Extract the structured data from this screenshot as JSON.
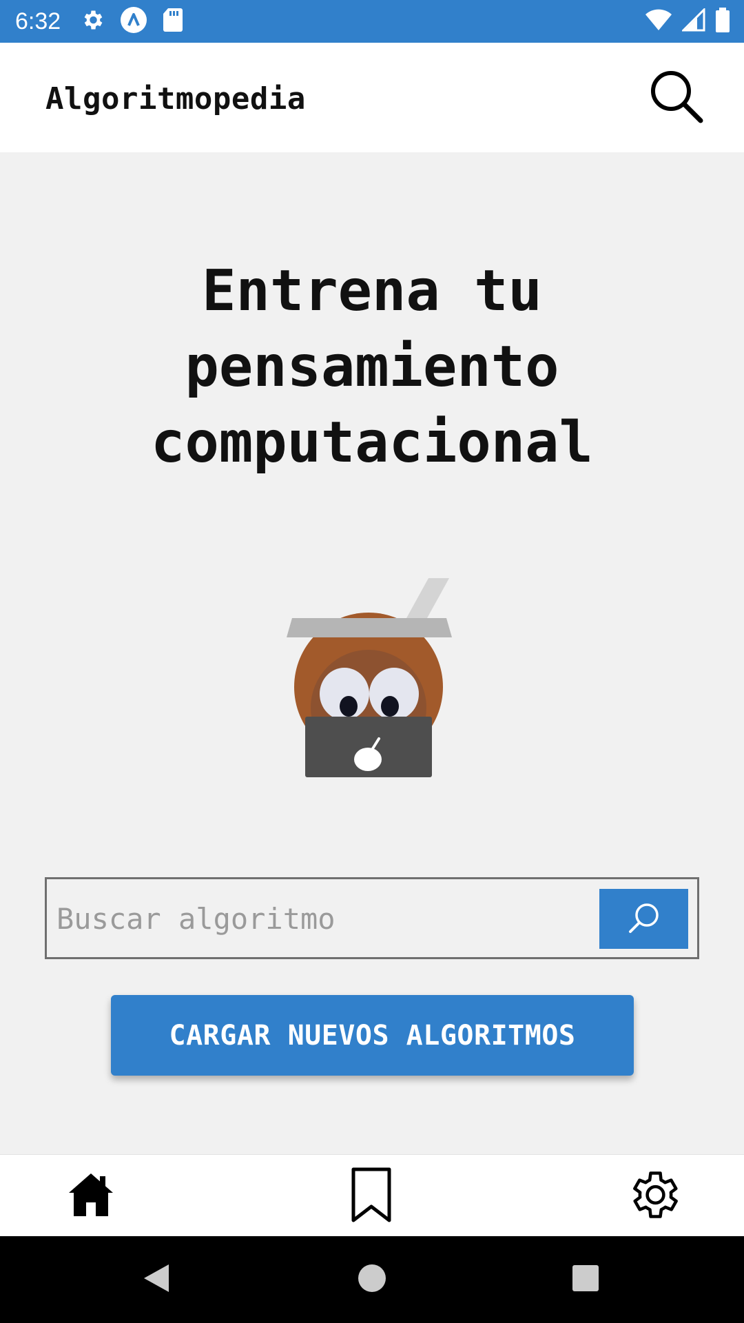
{
  "status_bar": {
    "time": "6:32",
    "left_icons": [
      "settings-icon",
      "app-a-icon",
      "sd-card-icon"
    ],
    "right_icons": [
      "wifi-icon",
      "signal-icon",
      "battery-icon"
    ]
  },
  "app_bar": {
    "title": "Algoritmopedia",
    "search_icon": "search-icon"
  },
  "hero": {
    "title_lines": [
      "Entrena tu",
      "pensamiento",
      "computacional"
    ]
  },
  "search": {
    "placeholder": "Buscar algoritmo",
    "value": ""
  },
  "load_button": {
    "label": "CARGAR NUEVOS ALGORITMOS"
  },
  "bottom_nav": {
    "items": [
      {
        "icon": "home-icon"
      },
      {
        "icon": "bookmark-icon"
      },
      {
        "icon": "gear-icon"
      }
    ]
  },
  "colors": {
    "primary": "#3180cb",
    "background": "#f1f1f1",
    "mascot_gourd": "#a25a2b",
    "mascot_laptop": "#4e4e4e"
  }
}
